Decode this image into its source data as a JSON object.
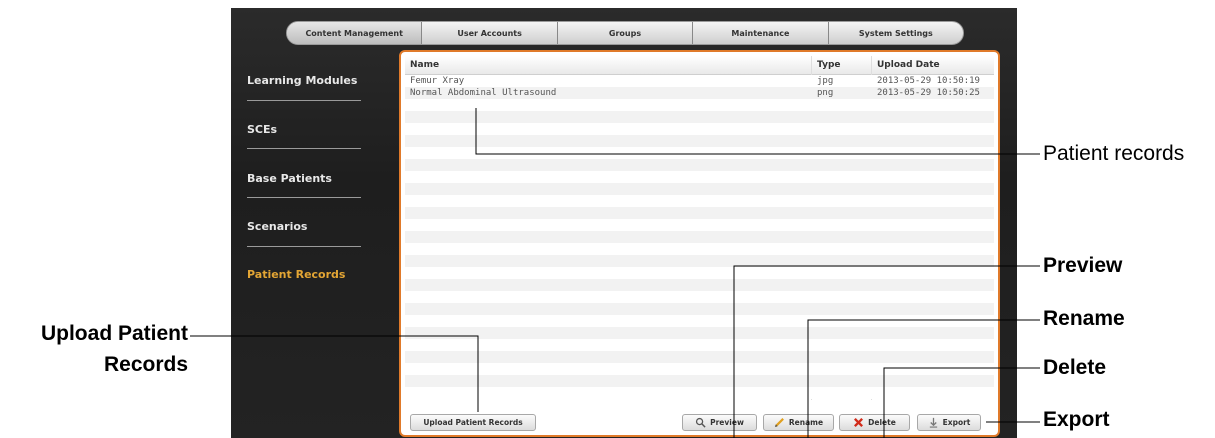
{
  "tabs": [
    {
      "label": "Content Management",
      "active": true
    },
    {
      "label": "User Accounts",
      "active": false
    },
    {
      "label": "Groups",
      "active": false
    },
    {
      "label": "Maintenance",
      "active": false
    },
    {
      "label": "System Settings",
      "active": false
    }
  ],
  "sidebar": {
    "items": [
      {
        "label": "Learning Modules",
        "active": false
      },
      {
        "label": "SCEs",
        "active": false
      },
      {
        "label": "Base Patients",
        "active": false
      },
      {
        "label": "Scenarios",
        "active": false
      },
      {
        "label": "Patient Records",
        "active": true
      }
    ]
  },
  "table": {
    "columns": [
      "Name",
      "Type",
      "Upload Date"
    ],
    "rows": [
      {
        "name": "Femur Xray",
        "type": "jpg",
        "date": "2013-05-29 10:50:19"
      },
      {
        "name": "Normal Abdominal Ultrasound",
        "type": "png",
        "date": "2013-05-29 10:50:25"
      }
    ]
  },
  "buttons": {
    "upload": "Upload Patient Records",
    "preview": "Preview",
    "rename": "Rename",
    "delete": "Delete",
    "export": "Export"
  },
  "callouts": {
    "patient_records": "Patient records",
    "preview": "Preview",
    "rename": "Rename",
    "delete": "Delete",
    "export": "Export",
    "upload_line1": "Upload Patient",
    "upload_line2": "Records"
  },
  "colors": {
    "accent": "#e07a2a",
    "active_sidebar": "#e3a534",
    "delete_icon": "#d12a1a"
  }
}
